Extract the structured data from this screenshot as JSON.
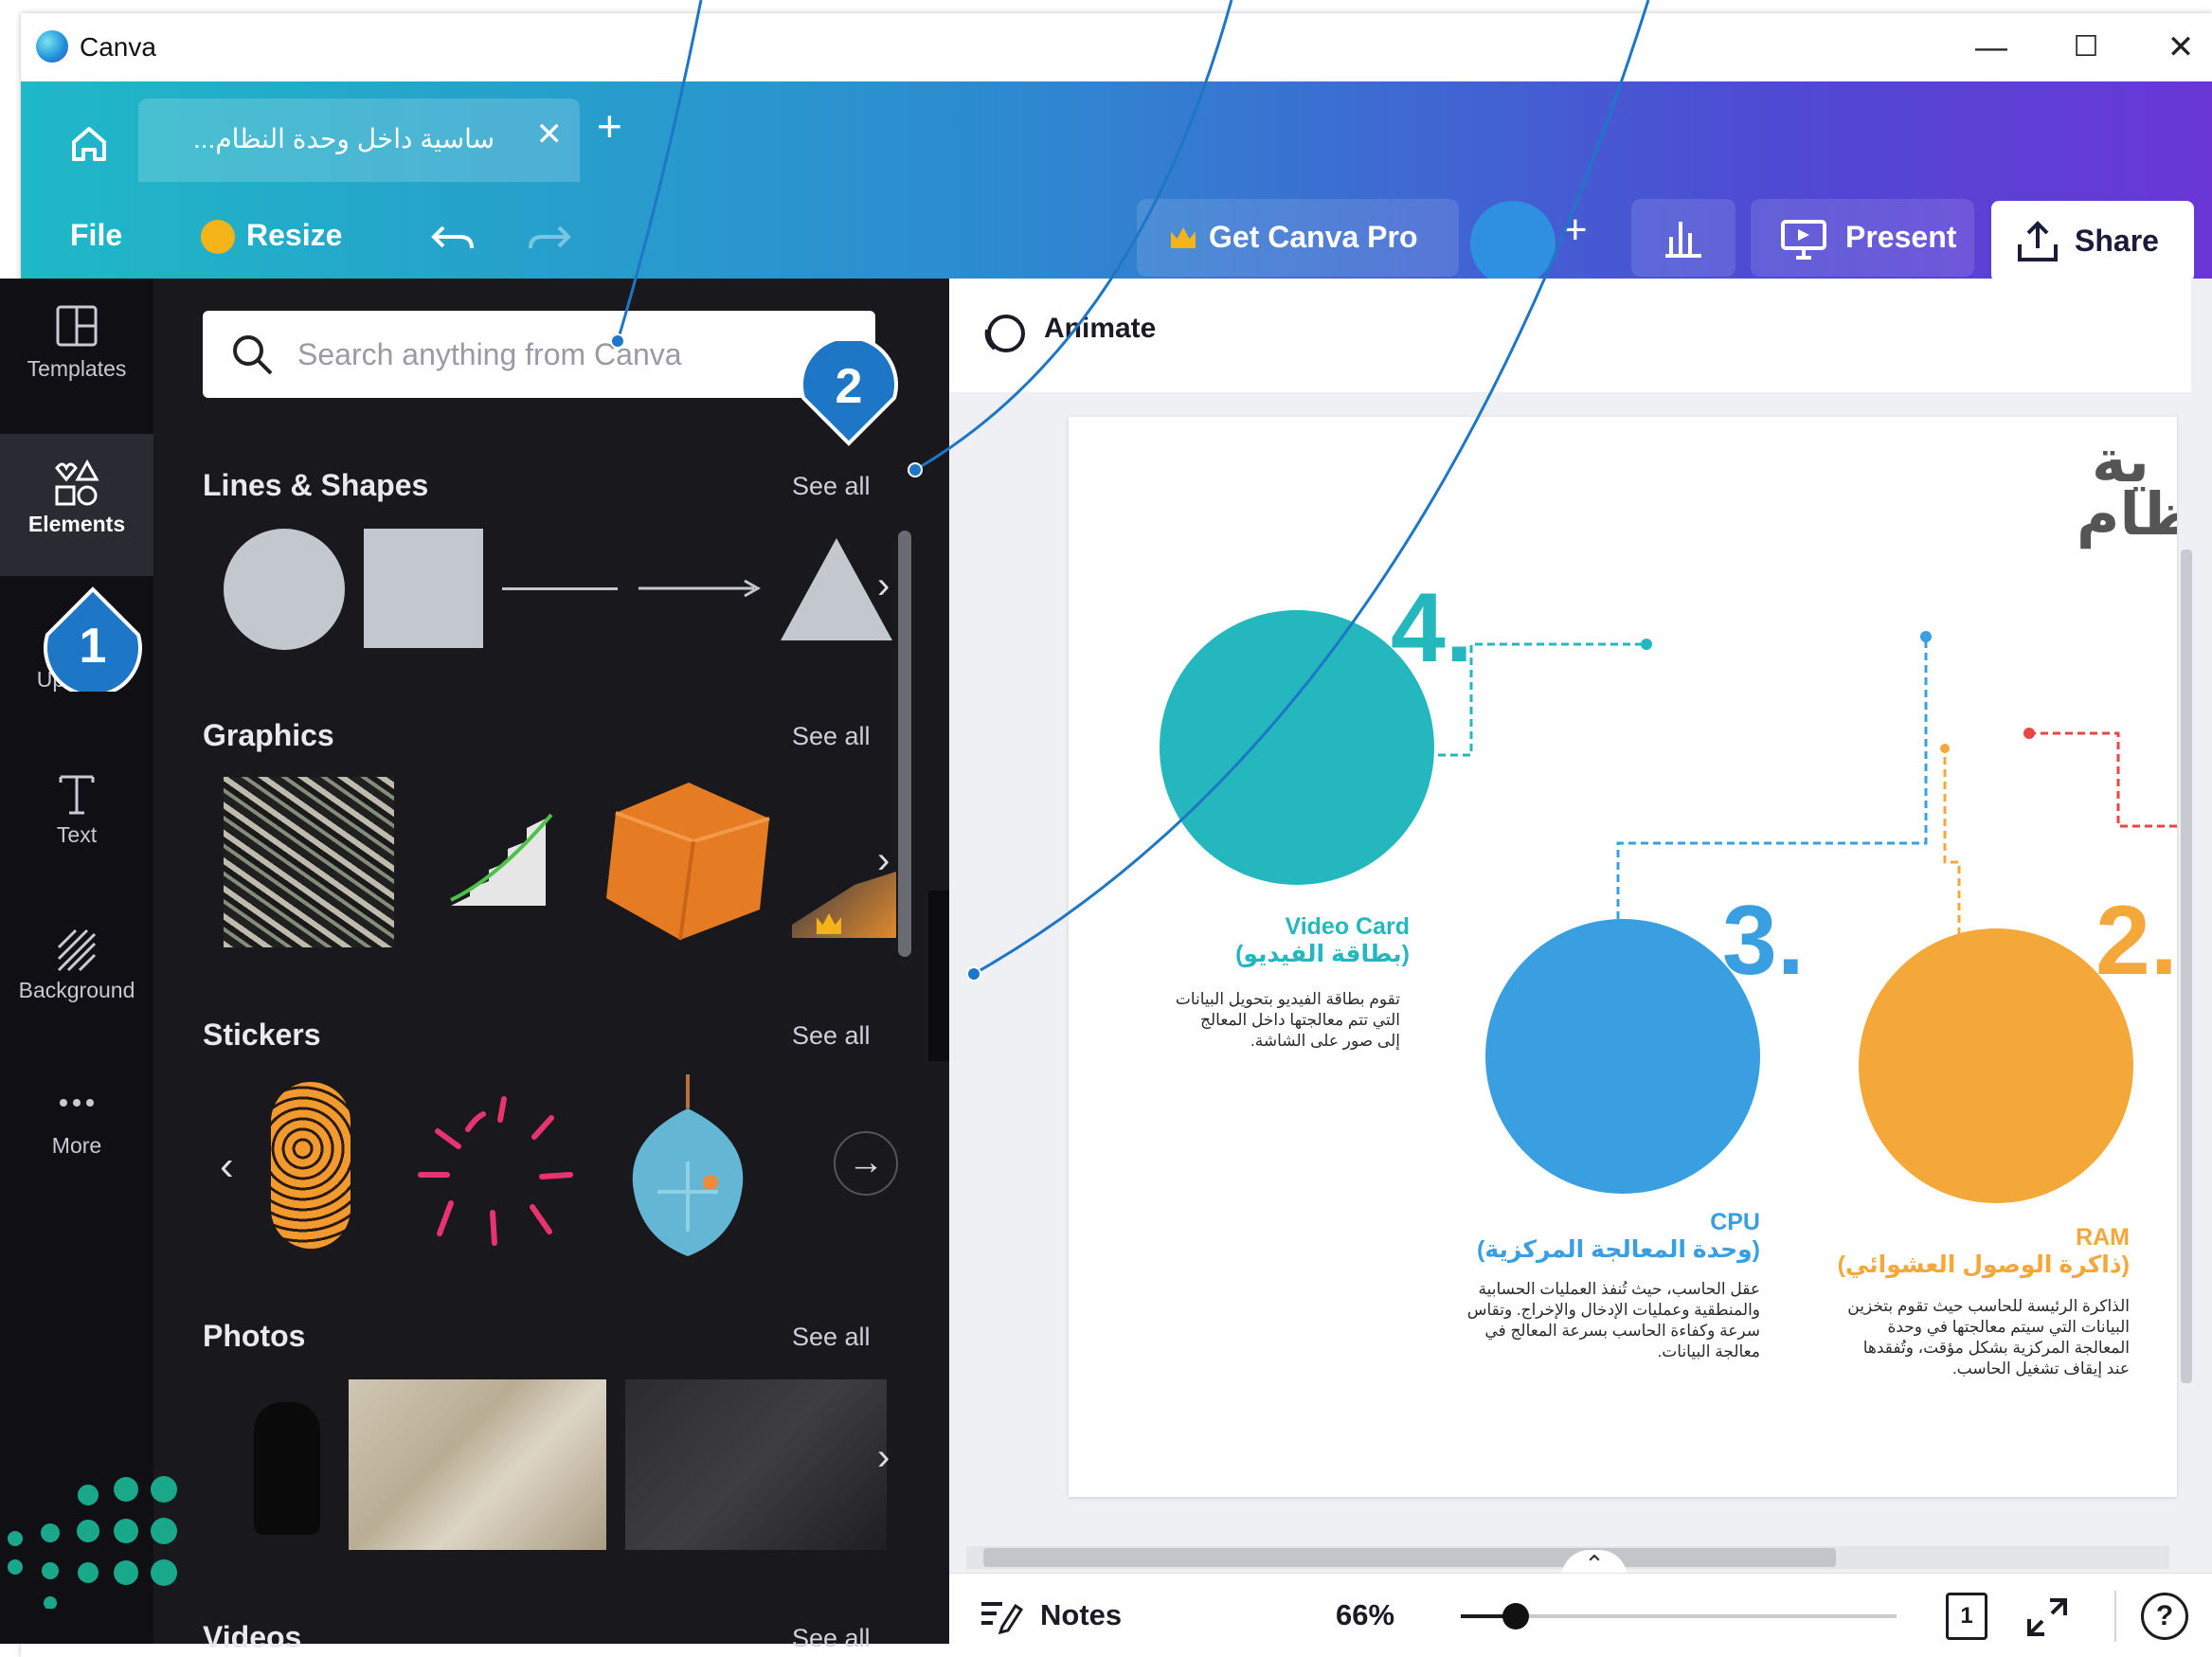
{
  "window": {
    "app_title": "Canva",
    "controls": {
      "minimize": "—",
      "maximize": "☐",
      "close": "✕"
    }
  },
  "tabs": {
    "doc_tab_label": "ساسية داخل وحدة النظام...",
    "close_glyph": "✕",
    "new_tab_glyph": "+"
  },
  "toolbar": {
    "file": "File",
    "resize": "Resize",
    "get_pro": "Get Canva Pro",
    "plus": "+",
    "present": "Present",
    "share": "Share"
  },
  "rail": {
    "items": [
      {
        "label": "Templates",
        "icon": "templates-icon"
      },
      {
        "label": "Elements",
        "icon": "elements-icon"
      },
      {
        "label": "Uploads",
        "icon": "uploads-icon"
      },
      {
        "label": "Text",
        "icon": "text-icon"
      },
      {
        "label": "Background",
        "icon": "background-icon"
      },
      {
        "label": "More",
        "icon": "more-icon"
      }
    ]
  },
  "panel": {
    "search_placeholder": "Search anything from Canva",
    "see_all": "See all",
    "sections": [
      "Lines & Shapes",
      "Graphics",
      "Stickers",
      "Photos",
      "Videos"
    ]
  },
  "canvas": {
    "animate": "Animate",
    "heading_partial": [
      "ية",
      "ظام"
    ],
    "items": [
      {
        "number": "4.",
        "title_en": "Video Card",
        "title_ar": "(بطاقة الفيديو)",
        "body": "تقوم بطاقة الفيديو بتحويل البيانات التي تتم معالجتها داخل المعالج إلى صور على الشاشة.",
        "color": "#24b8be"
      },
      {
        "number": "3.",
        "title_en": "CPU",
        "title_ar": "(وحدة المعالجة المركزية)",
        "body": "عقل الحاسب، حيث تُنفذ العمليات الحسابية والمنطقية وعمليات الإدخال والإخراج. وتقاس سرعة وكفاءة الحاسب بسرعة المعالج في معالجة البيانات.",
        "color": "#3a9fe0"
      },
      {
        "number": "2.",
        "title_en": "RAM",
        "title_ar": "(ذاكرة الوصول العشوائي)",
        "body": "الذاكرة الرئيسة للحاسب حيث تقوم بتخزين البيانات التي سيتم معالجتها في وحدة المعالجة المركزية بشكل مؤقت، وتُفقدها عند إيقاف تشغيل الحاسب.",
        "color": "#f5a83a"
      }
    ]
  },
  "footer": {
    "notes": "Notes",
    "zoom": "66%",
    "page_count": "1",
    "help": "?"
  },
  "callouts": [
    "1",
    "2"
  ],
  "colors": {
    "header_start": "#1fb8c7",
    "header_end": "#6a36d6",
    "panel_bg": "#18181d",
    "rail_bg": "#0f0f14",
    "callout_blue": "#1e77c6",
    "crown": "#f5b31a"
  }
}
